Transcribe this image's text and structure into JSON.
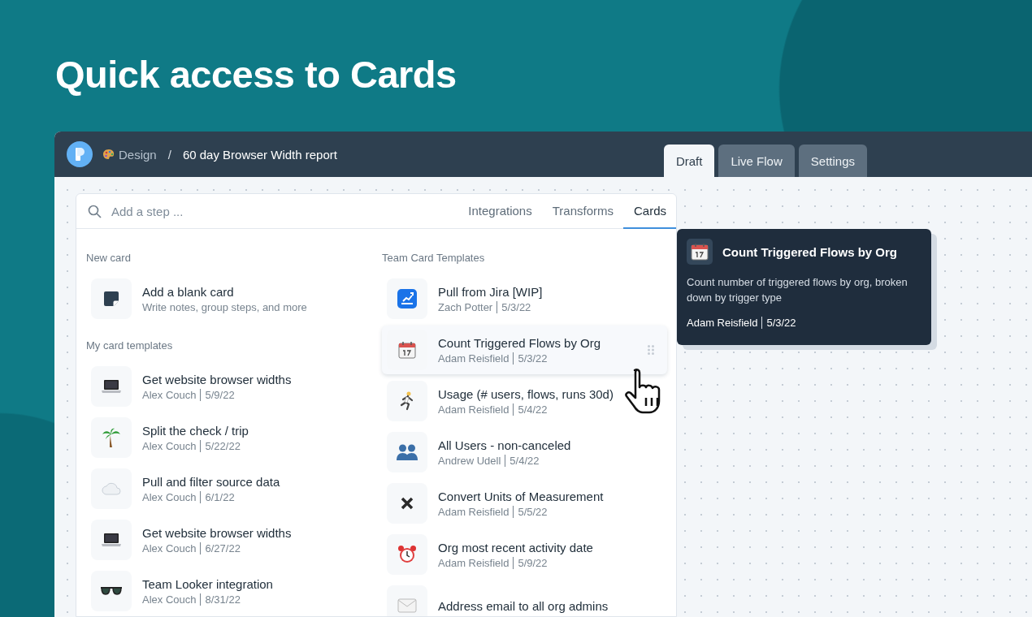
{
  "headline": "Quick access to Cards",
  "app": {
    "breadcrumb": {
      "folder": "Design",
      "separator": "/",
      "title": "60 day Browser Width report"
    },
    "tabs": [
      {
        "label": "Draft",
        "selected": true
      },
      {
        "label": "Live Flow",
        "selected": false
      },
      {
        "label": "Settings",
        "selected": false
      }
    ]
  },
  "step_picker": {
    "search": {
      "placeholder": "Add a step ..."
    },
    "tabs": [
      {
        "label": "Integrations",
        "selected": false
      },
      {
        "label": "Transforms",
        "selected": false
      },
      {
        "label": "Cards",
        "selected": true
      }
    ],
    "new_card": {
      "heading": "New card",
      "items": [
        {
          "title": "Add a blank card",
          "subtitle": "Write notes, group steps, and more"
        }
      ]
    },
    "my_templates": {
      "heading": "My card templates",
      "items": [
        {
          "title": "Get website browser widths",
          "author": "Alex Couch",
          "date": "5/9/22"
        },
        {
          "title": "Split the check / trip",
          "author": "Alex Couch",
          "date": "5/22/22"
        },
        {
          "title": "Pull and filter source data",
          "author": "Alex Couch",
          "date": "6/1/22"
        },
        {
          "title": "Get website browser widths",
          "author": "Alex Couch",
          "date": "6/27/22"
        },
        {
          "title": "Team Looker integration",
          "author": "Alex Couch",
          "date": "8/31/22"
        }
      ]
    },
    "team_templates": {
      "heading": "Team Card Templates",
      "items": [
        {
          "title": "Pull from Jira [WIP]",
          "author": "Zach Potter",
          "date": "5/3/22",
          "hovered": false
        },
        {
          "title": "Count Triggered Flows by Org",
          "author": "Adam Reisfield",
          "date": "5/3/22",
          "hovered": true
        },
        {
          "title": "Usage (# users, flows, runs 30d)",
          "author": "Adam Reisfield",
          "date": "5/4/22",
          "hovered": false
        },
        {
          "title": "All Users - non-canceled",
          "author": "Andrew Udell",
          "date": "5/4/22",
          "hovered": false
        },
        {
          "title": "Convert Units of Measurement",
          "author": "Adam Reisfield",
          "date": "5/5/22",
          "hovered": false
        },
        {
          "title": "Org most recent activity date",
          "author": "Adam Reisfield",
          "date": "5/9/22",
          "hovered": false
        },
        {
          "title": "Address email to all org admins",
          "hovered": false
        }
      ]
    }
  },
  "tooltip": {
    "title": "Count Triggered Flows by Org",
    "description": "Count number of triggered flows by org, broken down by trigger type",
    "author": "Adam Reisfield",
    "date": "5/3/22"
  }
}
